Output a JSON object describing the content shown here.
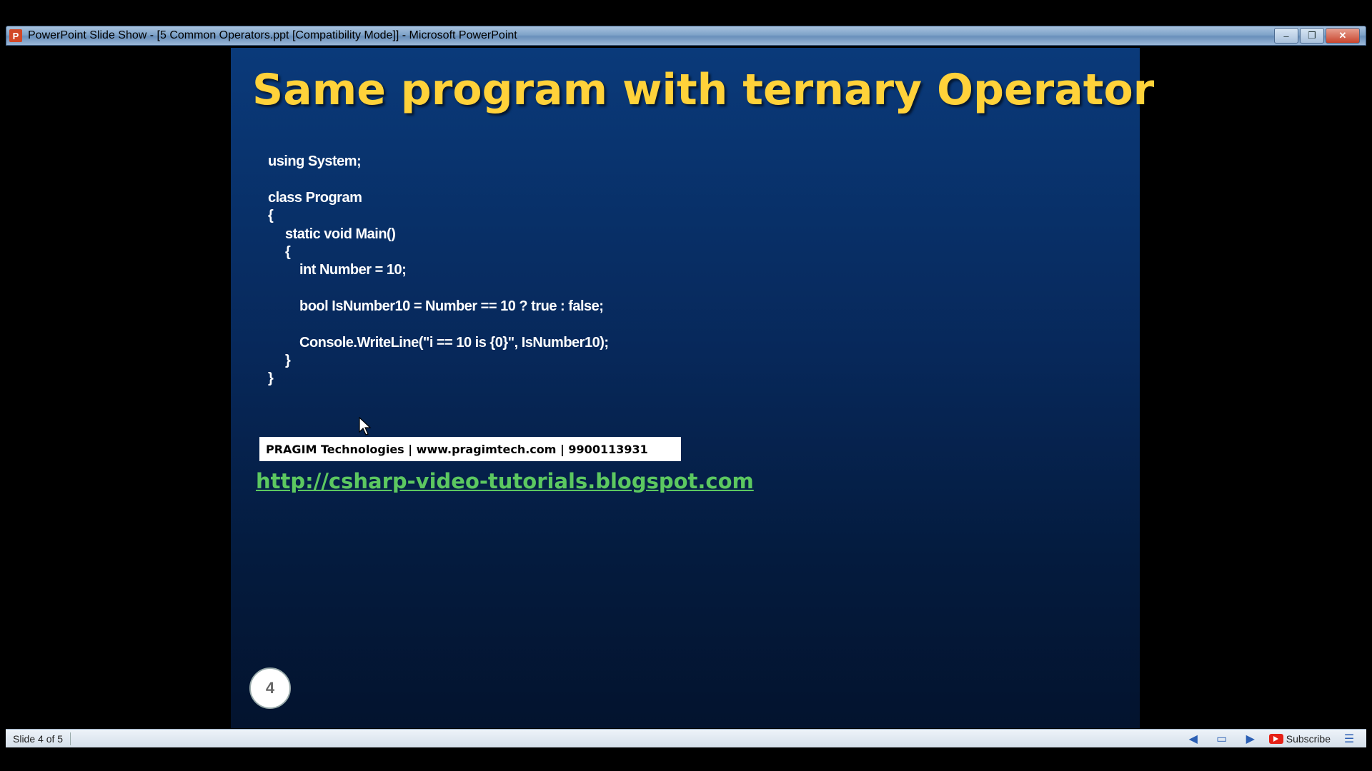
{
  "window": {
    "app_icon": "P",
    "title": "PowerPoint Slide Show - [5 Common Operators.ppt [Compatibility Mode]] - Microsoft PowerPoint",
    "minimize": "–",
    "restore": "❐",
    "close": "✕"
  },
  "slide": {
    "title": "Same program with ternary Operator",
    "code_lines": [
      "using System;",
      "class Program",
      "{",
      "static void Main()",
      "{",
      "int Number = 10;",
      "bool IsNumber10 = Number == 10 ? true : false;",
      "Console.WriteLine(\"i == 10 is {0}\", IsNumber10);",
      "}",
      "}"
    ],
    "banner": "PRAGIM Technologies | www.pragimtech.com | 9900113931",
    "link": "http://csharp-video-tutorials.blogspot.com",
    "number": "4"
  },
  "status": {
    "slide_indicator": "Slide 4 of 5",
    "prev_icon": "◀",
    "menu_icon": "▭",
    "next_icon": "▶",
    "subscribe_label": "Subscribe",
    "options_icon": "☰"
  },
  "colors": {
    "title": "#ffd23a",
    "link": "#5cc860",
    "slide_background": "#07285a"
  }
}
